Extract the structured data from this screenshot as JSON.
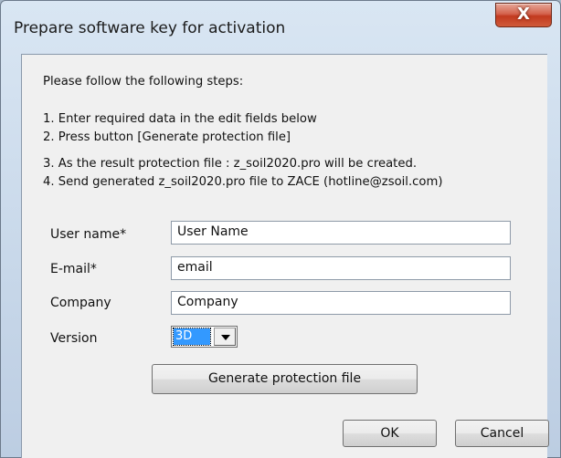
{
  "window": {
    "title": "Prepare software key for activation",
    "close_glyph": "X"
  },
  "instructions": {
    "intro": "Please follow the following steps:",
    "step1": "1. Enter required data in the edit fields below",
    "step2": "2. Press button [Generate protection file]",
    "step3": "3. As the result protection file : z_soil2020.pro will be created.",
    "step4": "4. Send generated z_soil2020.pro file to ZACE (hotline@zsoil.com)"
  },
  "form": {
    "user_name": {
      "label": "User name*",
      "value": "User Name"
    },
    "email": {
      "label": "E-mail*",
      "value": "email"
    },
    "company": {
      "label": "Company",
      "value": "Company"
    },
    "version": {
      "label": "Version",
      "value": "3D"
    }
  },
  "buttons": {
    "generate": "Generate protection file",
    "ok": "OK",
    "cancel": "Cancel"
  },
  "colors": {
    "close_button": "#c23a1f",
    "selection": "#3399ff"
  }
}
